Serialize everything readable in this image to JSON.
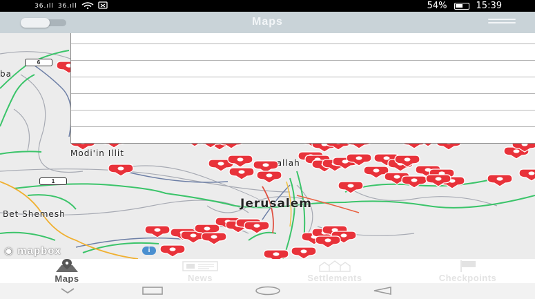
{
  "status_bar": {
    "signal_1": "36.ıll",
    "signal_2": "36.ıll",
    "battery": "54%",
    "time": "15:39"
  },
  "header": {
    "title": "Maps",
    "toggle_state": "off",
    "menu_icon": "hamburger-icon"
  },
  "map": {
    "labels": {
      "jerusalem": "Jerusalem",
      "modiin_illit": "Modi'in Illit",
      "bet_shemesh": "Bet Shemesh",
      "ramallah_partial": "mallah",
      "left_edge_partial": "ba"
    },
    "road_shields": {
      "route_6": "6",
      "route_1": "1"
    },
    "attribution": "mapbox",
    "info_icon": "info-icon",
    "marker_color": "#e8323a",
    "road_color": "#3bc46a"
  },
  "dropdown": {
    "rows": [
      "",
      "",
      "",
      "",
      "",
      "",
      ""
    ]
  },
  "bottom_nav": {
    "items": [
      {
        "label": "Maps",
        "icon": "map-pin-icon",
        "active": true
      },
      {
        "label": "News",
        "icon": "newspaper-icon",
        "active": false
      },
      {
        "label": "Settlements",
        "icon": "settlement-icon",
        "active": false
      },
      {
        "label": "Checkpoints",
        "icon": "flag-icon",
        "active": false
      }
    ]
  },
  "system_nav": {
    "buttons": [
      "chevron-down-icon",
      "recents-icon",
      "home-icon",
      "back-icon"
    ]
  }
}
